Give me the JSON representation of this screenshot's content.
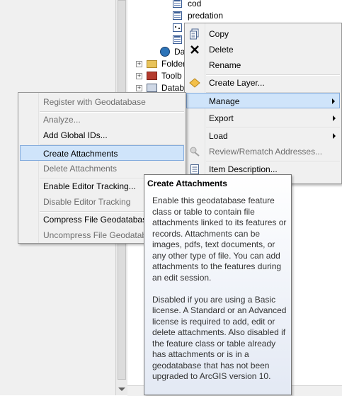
{
  "tree": {
    "items": [
      {
        "label": "cod",
        "icon": "feature-class-icon"
      },
      {
        "label": "predation",
        "icon": "feature-class-icon"
      },
      {
        "label": "",
        "icon": "point-feature-class-icon"
      },
      {
        "label": "",
        "icon": "feature-class-icon"
      },
      {
        "label": "Da",
        "icon": "globe-database-icon"
      },
      {
        "label": "Folder",
        "icon": "folder-icon"
      },
      {
        "label": "Toolb",
        "icon": "toolbox-icon"
      },
      {
        "label": "Datab",
        "icon": "database-icon"
      }
    ]
  },
  "context_menu": {
    "items": [
      {
        "label": "Copy",
        "icon": "copy-icon"
      },
      {
        "label": "Delete",
        "icon": "delete-x-icon"
      },
      {
        "label": "Rename"
      },
      {
        "label": "Create Layer...",
        "icon": "layer-icon"
      },
      {
        "label": "Manage",
        "submenu": true,
        "highlighted": true
      },
      {
        "label": "Export",
        "submenu": true
      },
      {
        "label": "Load",
        "submenu": true
      },
      {
        "label": "Review/Rematch Addresses...",
        "disabled": true,
        "icon": "review-icon"
      },
      {
        "label": "Item Description...",
        "icon": "item-description-icon"
      }
    ]
  },
  "manage_submenu": {
    "items": [
      {
        "label": "Register with Geodatabase",
        "disabled": true
      },
      {
        "label": "Analyze...",
        "disabled": true
      },
      {
        "label": "Add Global IDs..."
      },
      {
        "label": "Create Attachments",
        "highlighted": true
      },
      {
        "label": "Delete Attachments",
        "disabled": true
      },
      {
        "label": "Enable Editor Tracking..."
      },
      {
        "label": "Disable Editor Tracking",
        "disabled": true
      },
      {
        "label": "Compress File Geodatabase"
      },
      {
        "label": "Uncompress File Geodatabase",
        "disabled": true
      }
    ]
  },
  "tooltip": {
    "title": "Create Attachments",
    "body": "Enable this geodatabase feature class or table to contain file attachments linked to its features or records. Attachments can be images, pdfs, text documents, or any other type of file. You can add attachments to the features during an edit session.\n\nDisabled if you are using a Basic license. A Standard or an Advanced license is required to add, edit or delete attachments. Also disabled if the feature class or table already has attachments or is in a geodatabase that has not been upgraded to ArcGIS version 10."
  },
  "colors": {
    "menu_bg": "#f0f0f0",
    "highlight_bg": "#cfe4fa",
    "highlight_border": "#84acdd",
    "disabled_text": "#6d6d6d",
    "tooltip_border": "#767676"
  }
}
